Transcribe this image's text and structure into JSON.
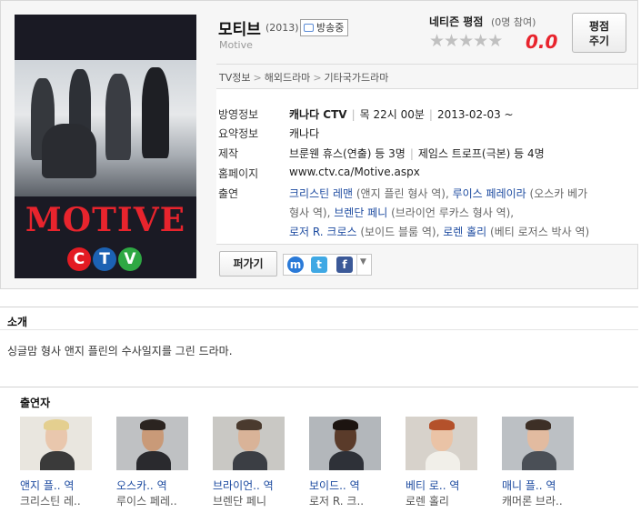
{
  "show": {
    "title": "모티브",
    "year": "(2013)",
    "onair_badge": "방송중",
    "original_title": "Motive",
    "poster_title": "MOTIVE",
    "poster_network": [
      "C",
      "T",
      "V"
    ]
  },
  "rating": {
    "label": "네티즌 평점",
    "count": "(0명 참여)",
    "score": "0.0",
    "stars_filled": 0,
    "stars_total": 5,
    "rate_button": [
      "평점",
      "주기"
    ]
  },
  "breadcrumb": [
    "TV정보",
    "해외드라마",
    "기타국가드라마"
  ],
  "details": {
    "broadcast": {
      "label": "방영정보",
      "channel": "캐나다 CTV",
      "time": "목 22시 00분",
      "date": "2013-02-03 ~"
    },
    "summary": {
      "label": "요약정보",
      "value": "캐나다"
    },
    "production": {
      "label": "제작",
      "director": "브룬웬 휴스(연출) 등 3명",
      "writer": "제임스 트로프(극본) 등 4명"
    },
    "homepage": {
      "label": "홈페이지",
      "value": "www.ctv.ca/Motive.aspx"
    },
    "cast": {
      "label": "출연",
      "line1": [
        {
          "name": "크리스틴 레맨",
          "role": " (앤지 플린 형사 역), "
        },
        {
          "name": "루이스 페레이라",
          "role": " (오스카 베가"
        }
      ],
      "line2": [
        {
          "name": "",
          "role": "형사 역), "
        },
        {
          "name": "브렌단 페니",
          "role": " (브라이언 루카스 형사 역),"
        }
      ],
      "line3": [
        {
          "name": "로저 R. 크로스",
          "role": " (보이드 블룸 역), "
        },
        {
          "name": "로렌 홀리",
          "role": " (베티 로저스 박사 역)"
        }
      ]
    }
  },
  "share": {
    "button": "퍼가기",
    "icons": [
      "me2day-icon",
      "twitter-icon",
      "facebook-icon"
    ]
  },
  "intro": {
    "title": "소개",
    "text": "싱글맘 형사 앤지 플린의 수사일지를 그린 드라마."
  },
  "cast_section": {
    "title": "출연자",
    "people": [
      {
        "role": "앤지 플.. 역",
        "actor": "크리스틴 레..",
        "bg": "#e9e6df",
        "skin": "#e9c7ad",
        "hair": "#e4cf8f",
        "cloth": "#3a3a3a"
      },
      {
        "role": "오스카.. 역",
        "actor": "루이스 페레..",
        "bg": "#bfc1c3",
        "skin": "#c99a78",
        "hair": "#2b2420",
        "cloth": "#2a2a2e"
      },
      {
        "role": "브라이언.. 역",
        "actor": "브렌단 페니",
        "bg": "#c9c8c4",
        "skin": "#d9b398",
        "hair": "#4a3a2e",
        "cloth": "#3b3e44"
      },
      {
        "role": "보이드.. 역",
        "actor": "로저 R. 크..",
        "bg": "#b3b7bb",
        "skin": "#5a3b2a",
        "hair": "#1c1410",
        "cloth": "#2e3138"
      },
      {
        "role": "베티 로.. 역",
        "actor": "로렌 홀리",
        "bg": "#d7d2cb",
        "skin": "#eac3a6",
        "hair": "#b4512b",
        "cloth": "#f1efe9"
      },
      {
        "role": "매니 플.. 역",
        "actor": "캐머론 브라..",
        "bg": "#bcc0c4",
        "skin": "#e2bba0",
        "hair": "#3d2f26",
        "cloth": "#4a4f56"
      }
    ]
  },
  "colors": {
    "accent_red": "#e8242d",
    "link_blue": "#1d4ba0",
    "ctv_red": "#e31b23",
    "ctv_blue": "#1c62b3",
    "ctv_green": "#2ea843"
  }
}
